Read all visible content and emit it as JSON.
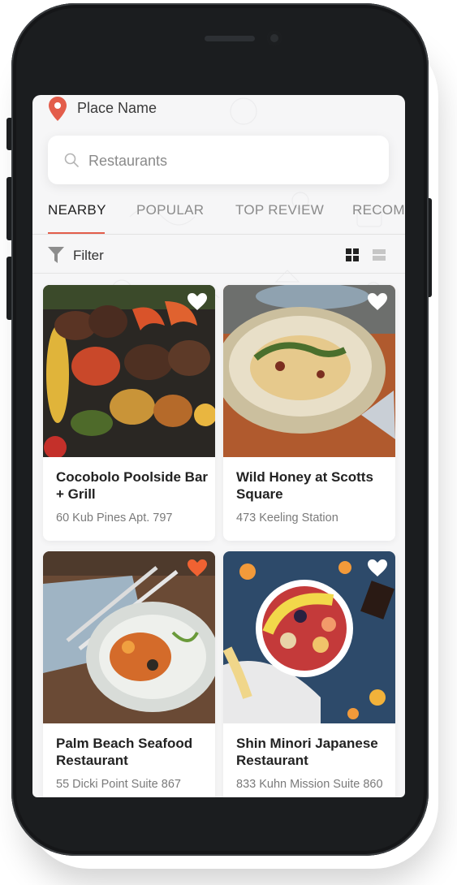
{
  "location": {
    "place_name": "Place Name",
    "icon": "map-pin-icon"
  },
  "search": {
    "placeholder": "Restaurants",
    "icon": "search-icon"
  },
  "tabs": [
    {
      "label": "NEARBY",
      "active": true
    },
    {
      "label": "POPULAR",
      "active": false
    },
    {
      "label": "TOP REVIEW",
      "active": false
    },
    {
      "label": "RECOMMENDED",
      "active": false
    }
  ],
  "filter": {
    "label": "Filter",
    "icon": "funnel-icon",
    "view_modes": [
      "grid-view-icon",
      "list-view-icon"
    ],
    "active_view": "grid"
  },
  "restaurants": [
    {
      "name": "Cocobolo Poolside Bar + Grill",
      "address": "60 Kub Pines Apt. 797",
      "favorite": false
    },
    {
      "name": "Wild Honey at Scotts Square",
      "address": "473 Keeling Station",
      "favorite": false
    },
    {
      "name": "Palm Beach Seafood Restaurant",
      "address": "55 Dicki Point Suite 867",
      "favorite": true
    },
    {
      "name": "Shin Minori Japanese Restaurant",
      "address": "833 Kuhn Mission Suite 860",
      "favorite": false
    }
  ],
  "colors": {
    "accent": "#e35d4b",
    "favorite": "#f06232",
    "heart_inactive": "#ffffff"
  }
}
